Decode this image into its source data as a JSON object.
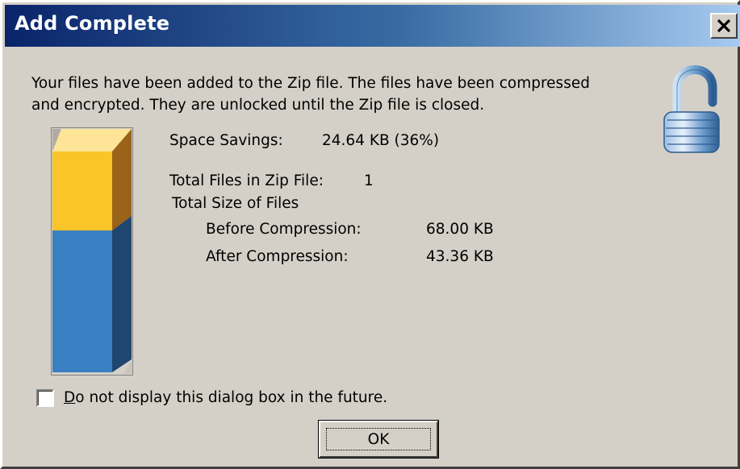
{
  "window": {
    "title": "Add Complete"
  },
  "message": {
    "line1": "Your files have been added to the Zip file. The files have been compressed",
    "line2": "and encrypted. They are unlocked until the Zip file is closed."
  },
  "lock_icon": "unlocked-padlock-icon",
  "stats": {
    "space_savings_label": "Space Savings:",
    "space_savings_value": "24.64 KB (36%)",
    "total_files_label": "Total Files in Zip File:",
    "total_files_value": "1",
    "total_size_label": "Total Size of Files",
    "before_label": "Before Compression:",
    "before_value": "68.00 KB",
    "after_label": "After Compression:",
    "after_value": "43.36 KB"
  },
  "compression_bar": {
    "savings_fraction": 0.36,
    "colors": {
      "savings": "#f9c528",
      "compressed": "#3a7fc1"
    }
  },
  "checkbox": {
    "label_mnemonic": "D",
    "label_rest": "o not display this dialog box in the future.",
    "checked": false
  },
  "ok_button": {
    "label": "OK"
  }
}
